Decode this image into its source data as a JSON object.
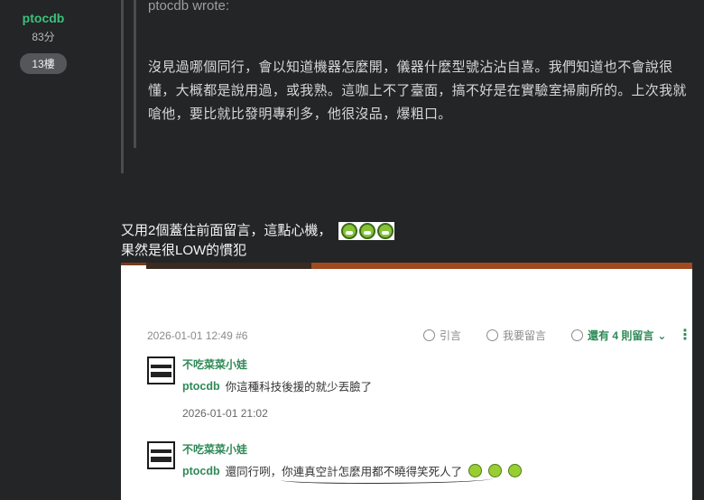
{
  "author": {
    "name": "ptocdb",
    "score": "83分",
    "floor": "13樓"
  },
  "quote": {
    "header": "ptocdb wrote:",
    "body": "沒見過哪個同行，會以知道機器怎麼開，儀器什麼型號沾沾自喜。我們知道也不會說很懂，大概都是說用過，或我熟。這咖上不了臺面，搞不好是在實驗室掃廁所的。上次我就嗆他，要比就比發明專利多，他很沒品，爆粗口。"
  },
  "reply": {
    "line1": "又用2個蓋住前面留言，這點心機，",
    "line2": "果然是很LOW的慣犯",
    "emoticons": [
      "grin-emoticon",
      "grin-emoticon",
      "grin-emoticon"
    ]
  },
  "screenshot": {
    "post_meta": "2026-01-01 12:49 #6",
    "actions": {
      "quote_label": "引言",
      "comment_label": "我要留言",
      "more_label": "還有 4 則留言"
    },
    "comments": [
      {
        "name": "不吃菜菜小娃",
        "mention": "ptocdb",
        "text": "你這種科技後援的就少丟臉了",
        "time": "2026-01-01 21:02"
      },
      {
        "name": "不吃菜菜小娃",
        "mention": "ptocdb",
        "text": "還同行咧，你連真空計怎麼用都不曉得笑死人了"
      }
    ],
    "colors": {
      "accent": "#2f8a57",
      "banner": "#a04a22"
    }
  }
}
